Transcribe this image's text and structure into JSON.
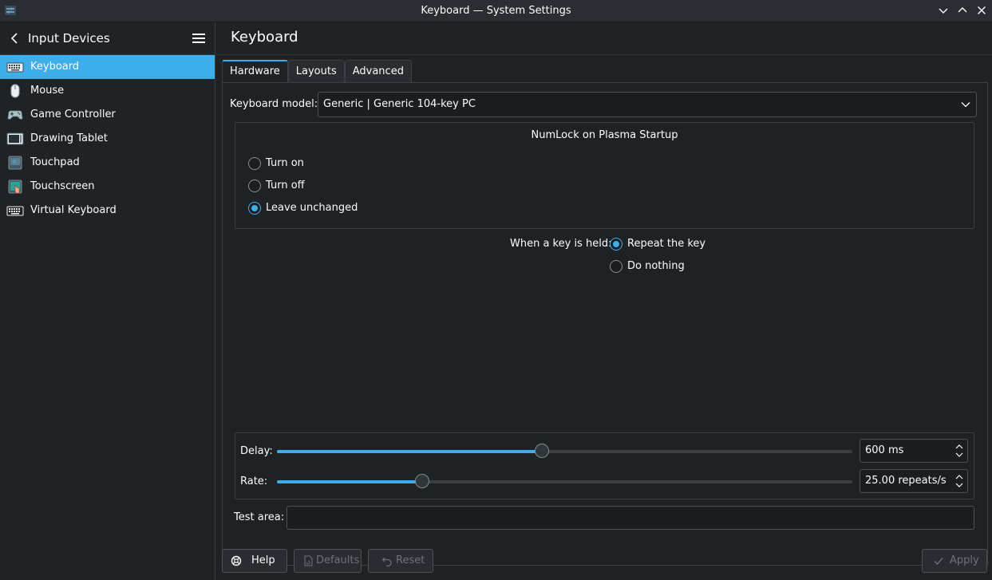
{
  "window": {
    "title": "Keyboard — System Settings"
  },
  "sidebar": {
    "header": "Input Devices",
    "items": [
      {
        "label": "Keyboard",
        "icon": "keyboard-icon",
        "active": true
      },
      {
        "label": "Mouse",
        "icon": "mouse-icon",
        "active": false
      },
      {
        "label": "Game Controller",
        "icon": "gamepad-icon",
        "active": false
      },
      {
        "label": "Drawing Tablet",
        "icon": "tablet-icon",
        "active": false
      },
      {
        "label": "Touchpad",
        "icon": "touchpad-icon",
        "active": false
      },
      {
        "label": "Touchscreen",
        "icon": "touchscreen-icon",
        "active": false
      },
      {
        "label": "Virtual Keyboard",
        "icon": "virtual-keyboard-icon",
        "active": false
      }
    ]
  },
  "main": {
    "title": "Keyboard",
    "tabs": [
      "Hardware",
      "Layouts",
      "Advanced"
    ],
    "model_label": "Keyboard model:",
    "model_value": "Generic | Generic 104-key PC",
    "numlock": {
      "title": "NumLock on Plasma Startup",
      "options": [
        "Turn on",
        "Turn off",
        "Leave unchanged"
      ],
      "selected": "Leave unchanged"
    },
    "key_held": {
      "label": "When a key is held:",
      "options": [
        "Repeat the key",
        "Do nothing"
      ],
      "selected": "Repeat the key"
    },
    "delay": {
      "label": "Delay:",
      "value": "600 ms",
      "fraction": 0.46
    },
    "rate": {
      "label": "Rate:",
      "value": "25.00 repeats/s",
      "fraction": 0.253
    },
    "test_area_label": "Test area:"
  },
  "footer": {
    "help": "Help",
    "defaults": "Defaults",
    "reset": "Reset",
    "apply": "Apply"
  },
  "colors": {
    "accent": "#3daee9",
    "background": "#202326"
  }
}
